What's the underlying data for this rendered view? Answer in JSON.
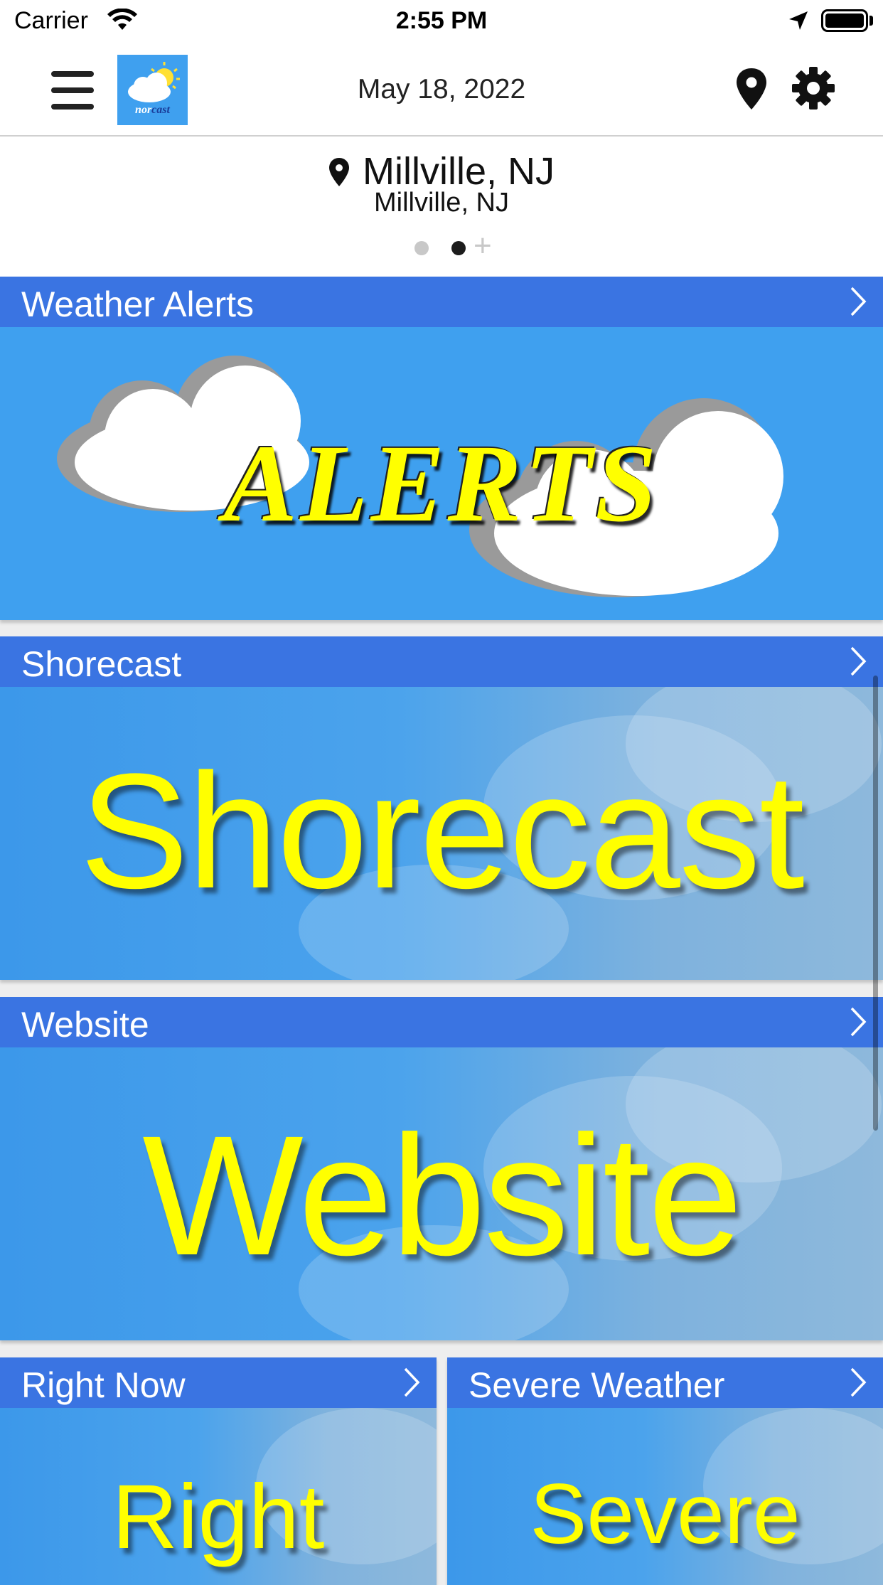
{
  "status_bar": {
    "carrier": "Carrier",
    "time": "2:55 PM"
  },
  "nav": {
    "date": "May 18, 2022",
    "logo_text_1": "nor",
    "logo_text_2": "cast"
  },
  "location": {
    "title": "Millville, NJ",
    "subtitle": "Millville, NJ",
    "page_count": 2,
    "current_page": 2
  },
  "cards": {
    "alerts": {
      "title": "Weather Alerts",
      "graphic_text": "ALERTS"
    },
    "shorecast": {
      "title": "Shorecast",
      "graphic_text": "Shorecast"
    },
    "website": {
      "title": "Website",
      "graphic_text": "Website"
    },
    "right_now": {
      "title": "Right Now",
      "graphic_text": "Right"
    },
    "severe": {
      "title": "Severe Weather",
      "graphic_text": "Severe"
    }
  },
  "icons": {
    "menu": "hamburger-menu-icon",
    "location": "map-pin-icon",
    "settings": "gear-icon",
    "chevron": "chevron-right-icon"
  },
  "colors": {
    "header_blue": "#3a74e2",
    "sky_blue": "#3fa0ef",
    "headline_yellow": "#ffff00"
  }
}
